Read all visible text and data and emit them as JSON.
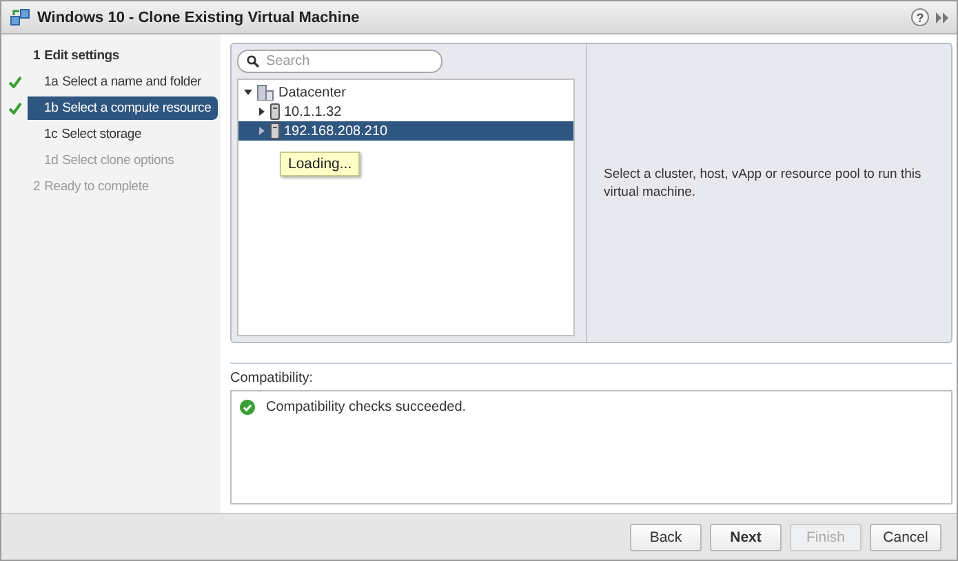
{
  "window": {
    "title": "Windows 10 - Clone Existing Virtual Machine",
    "help": "?"
  },
  "steps": [
    {
      "kind": "group",
      "number": "1",
      "label": "Edit settings",
      "done": false,
      "selected": false,
      "disabled": false
    },
    {
      "kind": "step",
      "number": "1a",
      "label": "Select a name and folder",
      "done": true,
      "selected": false,
      "disabled": false
    },
    {
      "kind": "step",
      "number": "1b",
      "label": "Select a compute resource",
      "done": true,
      "selected": true,
      "disabled": false
    },
    {
      "kind": "step",
      "number": "1c",
      "label": "Select storage",
      "done": false,
      "selected": false,
      "disabled": false
    },
    {
      "kind": "step",
      "number": "1d",
      "label": "Select clone options",
      "done": false,
      "selected": false,
      "disabled": true
    },
    {
      "kind": "group",
      "number": "2",
      "label": "Ready to complete",
      "done": false,
      "selected": false,
      "disabled": true
    }
  ],
  "search": {
    "placeholder": "Search"
  },
  "tree": [
    {
      "label": "Datacenter",
      "kind": "datacenter",
      "expanded": true,
      "selected": false,
      "children": [
        {
          "label": "10.1.1.32",
          "kind": "host",
          "expanded": false,
          "selected": false
        },
        {
          "label": "192.168.208.210",
          "kind": "host",
          "expanded": false,
          "selected": true
        }
      ]
    }
  ],
  "tooltip": "Loading...",
  "detail_text": "Select a cluster, host, vApp or resource pool to run this virtual machine.",
  "compatibility": {
    "label": "Compatibility:",
    "message": "Compatibility checks succeeded.",
    "ok": true
  },
  "buttons": [
    {
      "label": "Back",
      "disabled": false,
      "primary": false
    },
    {
      "label": "Next",
      "disabled": false,
      "primary": true
    },
    {
      "label": "Finish",
      "disabled": true,
      "primary": false
    },
    {
      "label": "Cancel",
      "disabled": false,
      "primary": false
    }
  ]
}
